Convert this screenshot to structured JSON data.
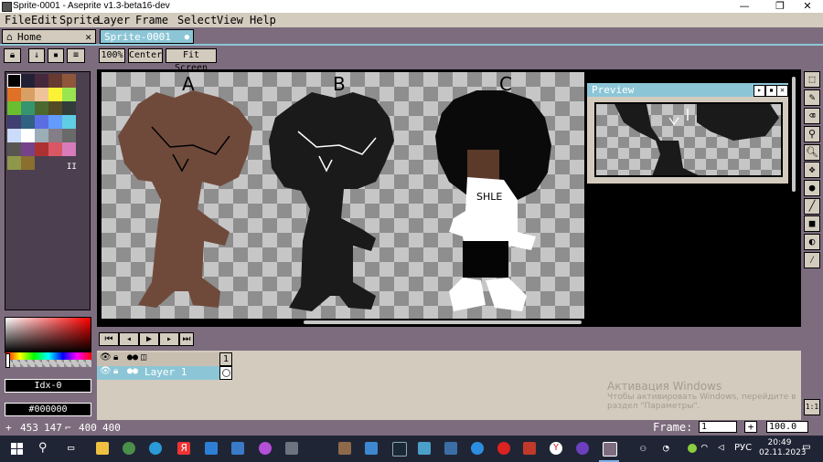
{
  "window": {
    "title": "Sprite-0001 - Aseprite v1.3-beta16-dev",
    "controls": {
      "minimize": "—",
      "maximize": "❐",
      "close": "✕"
    }
  },
  "menu": [
    "File",
    "Edit",
    "Sprite",
    "Layer",
    "Frame",
    "Select",
    "View",
    "Help"
  ],
  "tabs": [
    {
      "label": "Home",
      "close": "✕"
    },
    {
      "label": "Sprite-0001",
      "modified": "●"
    }
  ],
  "toolbar": {
    "zoom_100": "100%",
    "center": "Center",
    "fit_screen": "Fit Screen"
  },
  "palette": {
    "colors": [
      "#000000",
      "#222034",
      "#45283c",
      "#663931",
      "#8f563b",
      "#df7126",
      "#d9a066",
      "#eec39a",
      "#fbf236",
      "#99e550",
      "#6abe30",
      "#37946e",
      "#4b692f",
      "#524b24",
      "#323c39",
      "#3f3f74",
      "#306082",
      "#5b6ee1",
      "#639bff",
      "#5fcde4",
      "#cbdbfc",
      "#ffffff",
      "#9badb7",
      "#847e87",
      "#696a6a",
      "#595652",
      "#76428a",
      "#ac3232",
      "#d95763",
      "#d77bba",
      "#8f974a",
      "#8a6f30"
    ],
    "more_indicator": "II"
  },
  "color": {
    "index_label": "Idx-0",
    "hex_label": "#000000"
  },
  "canvas": {
    "labels": [
      "A",
      "B",
      "C"
    ],
    "shirt_text": "SHLE",
    "character_colors": [
      "#6f4a3b",
      "#1a1a1a",
      "#0a0a0a"
    ]
  },
  "preview": {
    "title": "Preview"
  },
  "timeline": {
    "frame_number": "1",
    "layer_name": "Layer 1"
  },
  "status": {
    "cursor_x": "453",
    "cursor_y": "147",
    "size_w": "400",
    "size_h": "400",
    "frame_label": "Frame:",
    "frame_value": "1",
    "add_frame": "+",
    "zoom_value": "100.0",
    "zoom_ratio": "1:1"
  },
  "watermark": {
    "title": "Активация Windows",
    "line1": "Чтобы активировать Windows, перейдите в",
    "line2": "раздел \"Параметры\"."
  },
  "taskbar": {
    "language": "РУС",
    "time": "20:49",
    "date": "02.11.2023"
  }
}
